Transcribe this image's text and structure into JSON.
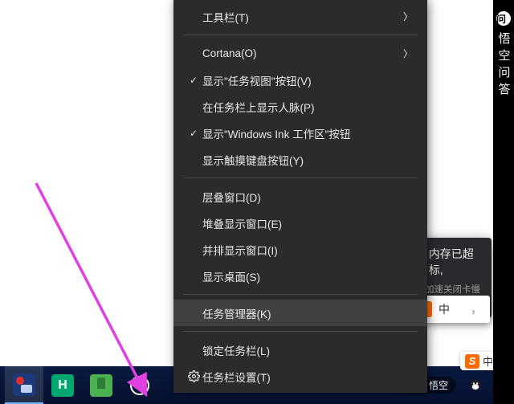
{
  "watermark": {
    "logo_glyph": "问",
    "text": "悟空问答"
  },
  "taskbar": {
    "h_label": "H"
  },
  "context_menu": {
    "sections": [
      {
        "items": [
          {
            "label": "工具栏(T)",
            "has_submenu": true
          },
          {
            "label": "Cortana(O)",
            "has_submenu": true
          },
          {
            "label": "显示\"任务视图\"按钮(V)",
            "checked": true
          },
          {
            "label": "在任务栏上显示人脉(P)"
          },
          {
            "label": "显示\"Windows Ink 工作区\"按钮",
            "checked": true
          },
          {
            "label": "显示触摸键盘按钮(Y)"
          }
        ]
      },
      {
        "items": [
          {
            "label": "层叠窗口(D)"
          },
          {
            "label": "堆叠显示窗口(E)"
          },
          {
            "label": "并排显示窗口(I)"
          },
          {
            "label": "显示桌面(S)"
          }
        ]
      },
      {
        "items": [
          {
            "label": "任务管理器(K)",
            "highlight": true
          }
        ]
      },
      {
        "items": [
          {
            "label": "锁定任务栏(L)"
          },
          {
            "label": "任务栏设置(T)",
            "icon": "gear"
          }
        ]
      }
    ]
  },
  "notification": {
    "title": "内存已超标,",
    "subtitle": "深度加速关闭卡慢进程"
  },
  "ime": {
    "s_label": "S",
    "text": "中",
    "trail": "，"
  },
  "wukong_small": {
    "text": "悟空"
  },
  "tray_badge": {
    "s": "S",
    "zh": "中"
  }
}
